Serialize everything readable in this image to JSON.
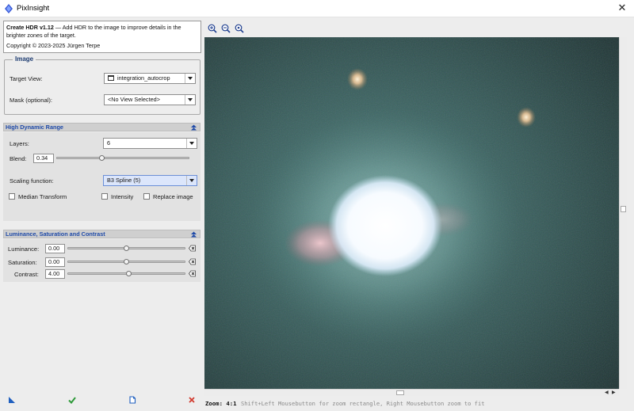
{
  "window": {
    "title": "PixInsight",
    "close_glyph": "✕"
  },
  "description": {
    "name": "Create HDR v1.12",
    "text": " — Add HDR to the image to improve details in the brighter zones of the target.",
    "copyright": "Copyright © 2023-2025 Jürgen Terpe"
  },
  "image_group": {
    "title": "Image",
    "target_view_label": "Target View:",
    "target_view_value": "integration_autocrop",
    "mask_label": "Mask (optional):",
    "mask_value": "<No View Selected>"
  },
  "hdr_section": {
    "title": "High Dynamic Range",
    "layers_label": "Layers:",
    "layers_value": "6",
    "blend_label": "Blend:",
    "blend_value": "0.34",
    "blend_level": 0.34,
    "scaling_label": "Scaling function:",
    "scaling_value": "B3 Spline (5)",
    "median_label": "Median Transform",
    "intensity_label": "Intensity",
    "replace_label": "Replace image",
    "median_checked": false,
    "intensity_checked": false,
    "replace_checked": false
  },
  "lsc_section": {
    "title": "Luminance, Saturation and Contrast",
    "luminance_label": "Luminance:",
    "luminance_value": "0.00",
    "saturation_label": "Saturation:",
    "saturation_value": "0.00",
    "contrast_label": "Contrast:",
    "contrast_value": "4.00",
    "luminance_level": 0.5,
    "saturation_level": 0.5,
    "contrast_level": 0.52
  },
  "preview": {
    "zoom_label": "Zoom: 4:1",
    "hint": "Shift+Left Mousebutton for zoom rectangle, Right Mousebutton zoom to fit"
  },
  "icons": {
    "new_instance": "triangle-icon",
    "execute": "check-icon",
    "browse_doc": "document-icon",
    "cancel": "close-icon",
    "zoom_in": "zoom-in-icon",
    "zoom_out": "zoom-out-icon",
    "zoom_fit": "zoom-fit-icon"
  },
  "colors": {
    "section_title": "#1f4aa8",
    "execute_green": "#2f9a3a",
    "cancel_red": "#d23a2e",
    "selected_combo": "#dce6fb"
  }
}
